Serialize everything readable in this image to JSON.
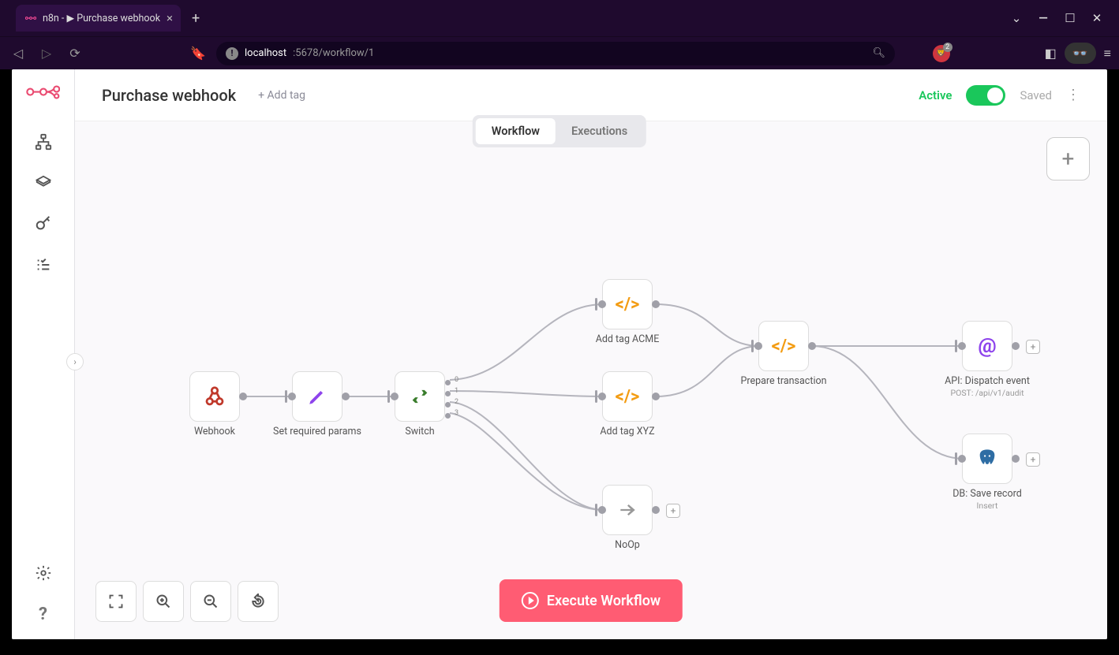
{
  "browser": {
    "tab_title": "n8n - ▶ Purchase webhook",
    "url_host": "localhost",
    "url_port_path": ":5678/workflow/1"
  },
  "header": {
    "workflow_name": "Purchase webhook",
    "add_tag": "+ Add tag",
    "active_label": "Active",
    "saved_label": "Saved"
  },
  "tabs": {
    "workflow": "Workflow",
    "executions": "Executions"
  },
  "nodes": {
    "webhook": {
      "label": "Webhook"
    },
    "set_params": {
      "label": "Set required params"
    },
    "switch": {
      "label": "Switch",
      "outputs": [
        "0",
        "1",
        "2",
        "3"
      ]
    },
    "tag_acme": {
      "label": "Add tag ACME"
    },
    "tag_xyz": {
      "label": "Add tag XYZ"
    },
    "noop": {
      "label": "NoOp"
    },
    "prepare": {
      "label": "Prepare transaction"
    },
    "api_dispatch": {
      "label": "API: Dispatch event",
      "sub": "POST: /api/v1/audit"
    },
    "db_save": {
      "label": "DB: Save record",
      "sub": "Insert"
    }
  },
  "buttons": {
    "execute": "Execute Workflow"
  }
}
